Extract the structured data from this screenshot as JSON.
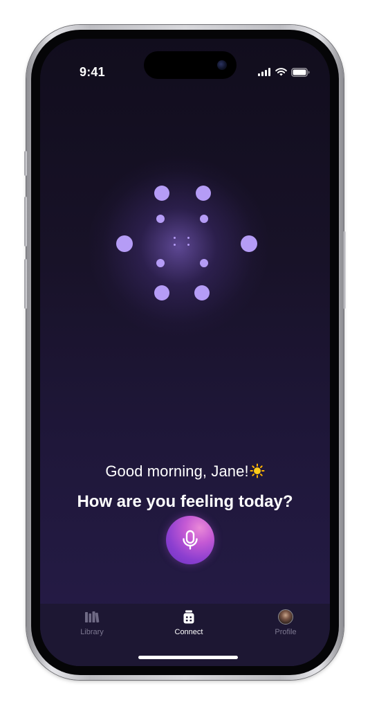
{
  "status_bar": {
    "time": "9:41",
    "icons": [
      "cellular-signal-icon",
      "wifi-icon",
      "battery-icon"
    ]
  },
  "main": {
    "greeting": "Good morning, Jane!",
    "greeting_emoji_icon": "sun-icon",
    "question": "How are you feeling today?",
    "mic_icon": "microphone-icon",
    "orb_icon": "dot-orb-animation"
  },
  "tab_bar": {
    "items": [
      {
        "label": "Library",
        "icon": "library-books-icon",
        "active": false
      },
      {
        "label": "Connect",
        "icon": "connect-icon",
        "active": true
      },
      {
        "label": "Profile",
        "icon": "avatar",
        "active": false
      }
    ]
  },
  "colors": {
    "background_top": "#110d1d",
    "background_bottom": "#261c48",
    "accent_dots": "#b59cf6",
    "mic_gradient_start": "#ea8ad8",
    "mic_gradient_end": "#6a31c2",
    "active_tab": "#ffffff",
    "inactive_tab": "#7d7891"
  }
}
